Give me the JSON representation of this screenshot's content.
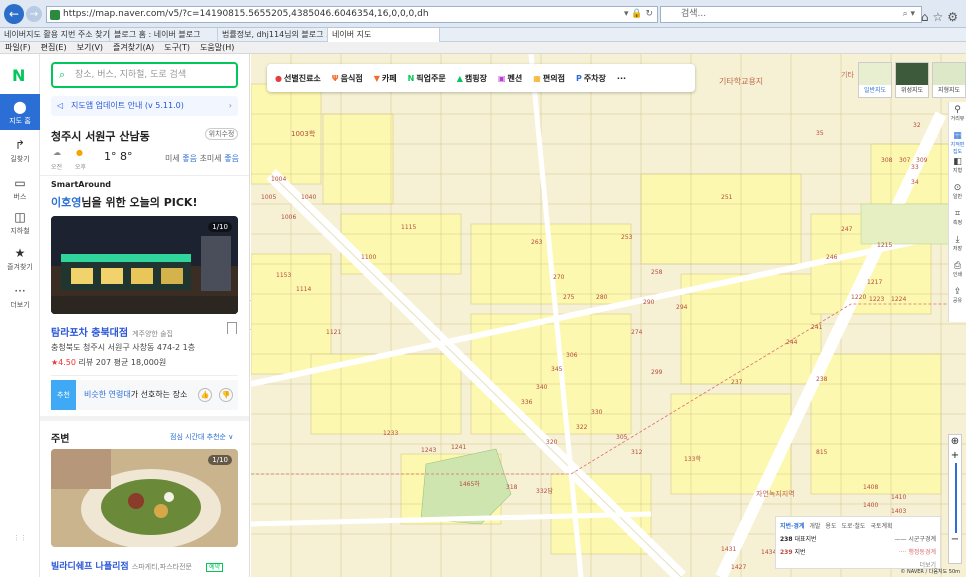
{
  "browser": {
    "url": "https://map.naver.com/v5/?c=14190815.5655205,4385046.6046354,16,0,0,0,dh",
    "search_placeholder": "검색...",
    "tabs": [
      "네이버지도 활용 지번 주소 찾기",
      "블로그 홈 : 네이버 블로그",
      "법률정보, dhj114님의 블로그 ...",
      "네이버 지도"
    ],
    "active_tab": 3,
    "menu": [
      "파일(F)",
      "편집(E)",
      "보기(V)",
      "즐겨찾기(A)",
      "도구(T)",
      "도움말(H)"
    ]
  },
  "rail": {
    "logo": "N",
    "items": [
      {
        "label": "지도 홈",
        "icon": "location-pin-icon"
      },
      {
        "label": "길찾기",
        "icon": "directions-icon"
      },
      {
        "label": "버스",
        "icon": "bus-icon"
      },
      {
        "label": "지하철",
        "icon": "subway-icon"
      },
      {
        "label": "즐겨찾기",
        "icon": "star-icon"
      },
      {
        "label": "더보기",
        "icon": "more-icon"
      }
    ]
  },
  "panel": {
    "search_placeholder": "장소, 버스, 지하철, 도로 검색",
    "update_notice": "지도앱 업데이트 안내 (v 5.11.0)",
    "location_title": "청주시 서원구 산남동",
    "location_set_btn": "위치수정",
    "weather": {
      "am_label": "오전",
      "pm_label": "오후",
      "temps": "1° 8°",
      "dust_label": "미세",
      "dust_value": "좋음",
      "ultra_label": "초미세",
      "ultra_value": "좋음"
    },
    "smart_around": "SmartAround",
    "pick_user": "이호영",
    "pick_text": "님을 위한 오늘의 PICK!",
    "photo1_count": "1/10",
    "place1": {
      "name": "탐라포차 충북대점",
      "category": "계주양한 술집",
      "address": "충청북도 청주시 서원구 사창동 474-2 1층",
      "rating": "★4.50",
      "reviews": "리뷰 207",
      "price": "평균 18,000원"
    },
    "reco": {
      "tag": "추천",
      "highlight": "비슷한 연령대",
      "text": "가 선호하는 장소"
    },
    "section_title": "주변",
    "sort_label": "점심 시간대 추천순 ∨",
    "photo2_count": "1/10",
    "place2": {
      "name": "빌라디쉐프 나폴리점",
      "category": "스파게티,파스타전문",
      "badge": "예약"
    }
  },
  "map": {
    "categories": [
      {
        "label": "선별진료소",
        "icon": "clinic-icon",
        "color": "#e33e3e"
      },
      {
        "label": "음식점",
        "icon": "restaurant-icon",
        "color": "#f26b2b"
      },
      {
        "label": "카페",
        "icon": "cafe-icon",
        "color": "#f26b2b"
      },
      {
        "label": "픽업주문",
        "icon": "pickup-icon",
        "color": "#03c75a"
      },
      {
        "label": "캠핑장",
        "icon": "camping-icon",
        "color": "#03c75a"
      },
      {
        "label": "펜션",
        "icon": "pension-icon",
        "color": "#c03bd6"
      },
      {
        "label": "편의점",
        "icon": "store-icon",
        "color": "#f5a400"
      },
      {
        "label": "주차장",
        "icon": "parking-icon",
        "color": "#2b6fd6"
      },
      {
        "label": "···",
        "icon": "more-icon",
        "color": "#333"
      }
    ],
    "map_types": [
      "일반지도",
      "위성지도",
      "지형지도"
    ],
    "area_labels": [
      "기타학교용지",
      "기타",
      "1003학",
      "자연녹지지역",
      "133학",
      "815",
      "1465하",
      "332답"
    ],
    "parcel_labels": [
      "1004",
      "1005",
      "1006",
      "1040",
      "1153",
      "1114",
      "1100",
      "1115",
      "1121",
      "1233",
      "1243",
      "1241",
      "1434",
      "1427",
      "1431",
      "1438",
      "1408",
      "1400",
      "1410",
      "1403",
      "1215",
      "1217",
      "1220",
      "1223",
      "1224",
      "238",
      "237",
      "244",
      "241",
      "246",
      "247",
      "251",
      "253",
      "258",
      "263",
      "270",
      "274",
      "275",
      "280",
      "290",
      "294",
      "299",
      "305",
      "312",
      "318",
      "320",
      "322",
      "330",
      "336",
      "340",
      "345",
      "306",
      "307",
      "308",
      "309",
      "33",
      "32",
      "34",
      "35",
      "64",
      "75",
      "124"
    ],
    "right_tools": [
      "거리뷰",
      "지적편집도",
      "지형",
      "일반",
      "측정",
      "저장",
      "인쇄",
      "공유"
    ],
    "legend": {
      "tabs": [
        "지번·경계",
        "개발",
        "용도",
        "도로·철도",
        "국토계획"
      ],
      "rows": [
        {
          "code": "238",
          "label": "대표지번"
        },
        {
          "code": "239",
          "label": "지번"
        }
      ],
      "lines": [
        "시군구경계",
        "행정동경계"
      ],
      "more": "더보기"
    },
    "scale": "© NAVER / 다음지도 50m"
  }
}
